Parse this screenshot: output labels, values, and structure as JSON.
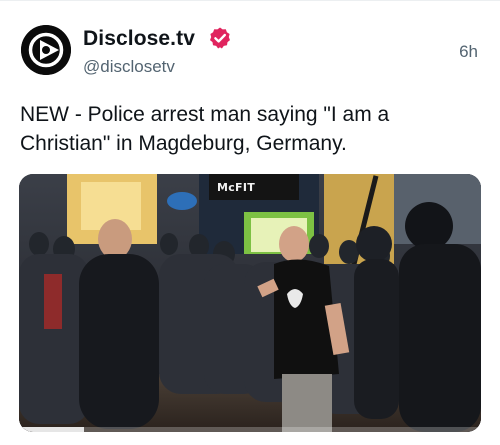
{
  "post": {
    "display_name": "Disclose.tv",
    "handle": "@disclosetv",
    "timestamp": "6h",
    "text": "NEW - Police arrest man saying \"I am a Christian\" in Magdeburg, Germany."
  },
  "media": {
    "sign_text": "McFIT",
    "progress_fraction": 0.14
  },
  "icons": {
    "avatar": "play-logo-icon",
    "verified": "verified-badge-icon"
  },
  "colors": {
    "verified_badge": "#e0245e",
    "secondary_text": "#536471",
    "primary_text": "#0f1419"
  }
}
